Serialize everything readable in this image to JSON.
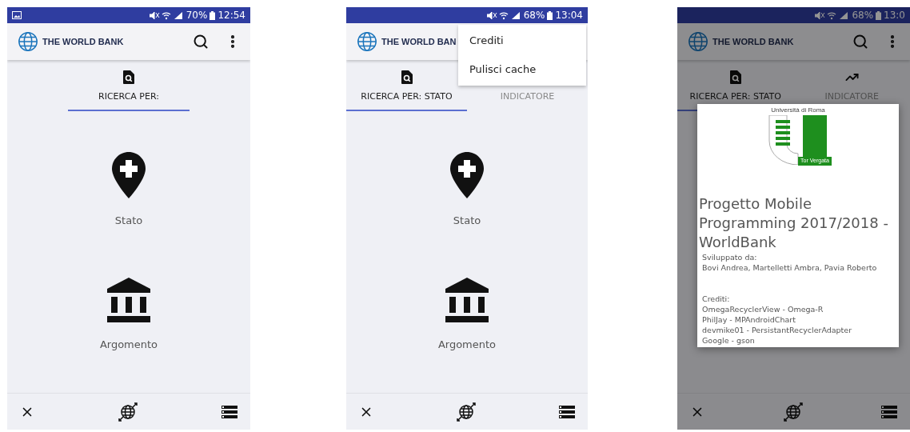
{
  "screens": [
    {
      "status_bar": {
        "notification_icon": true,
        "battery": "70%",
        "time": "12:54"
      },
      "app_bar": {
        "title": "THE WORLD BANK",
        "actions": true
      },
      "tabs": [
        {
          "label": "RICERCA PER:",
          "kind": "search",
          "selected": true
        }
      ],
      "options": [
        {
          "label": "Stato",
          "kind": "place"
        },
        {
          "label": "Argomento",
          "kind": "topic"
        }
      ]
    },
    {
      "status_bar": {
        "notification_icon": false,
        "battery": "68%",
        "time": "13:04"
      },
      "app_bar": {
        "title": "THE WORLD BAN"
      },
      "tabs": [
        {
          "label": "RICERCA PER: STATO",
          "kind": "search",
          "selected": true
        },
        {
          "label": "INDICATORE",
          "kind": "plain",
          "selected": false
        }
      ],
      "options": [
        {
          "label": "Stato",
          "kind": "place"
        },
        {
          "label": "Argomento",
          "kind": "topic"
        }
      ],
      "menu": [
        "Crediti",
        "Pulisci cache"
      ]
    },
    {
      "status_bar": {
        "notification_icon": false,
        "battery": "68%",
        "time": "13:0"
      },
      "app_bar": {
        "title": "THE WORLD BANK",
        "actions": true
      },
      "tabs": [
        {
          "label": "RICERCA PER: STATO",
          "kind": "search",
          "selected": true
        },
        {
          "label": "INDICATORE",
          "kind": "indicator",
          "selected": false
        }
      ],
      "dialog": {
        "logo_top": "Università di Roma",
        "logo_bottom": "Tor Vergata",
        "title": "Progetto Mobile Programming 2017/2018 - WorldBank",
        "developed_label": "Sviluppato da:",
        "developers": "Bovi Andrea, Martelletti Ambra, Pavia Roberto",
        "credits_label": "Crediti:",
        "credits": [
          "OmegaRecyclerView - Omega-R",
          "PhilJay - MPAndroidChart",
          "devmike01 - PersistantRecyclerAdapter",
          "Google - gson"
        ]
      }
    }
  ]
}
